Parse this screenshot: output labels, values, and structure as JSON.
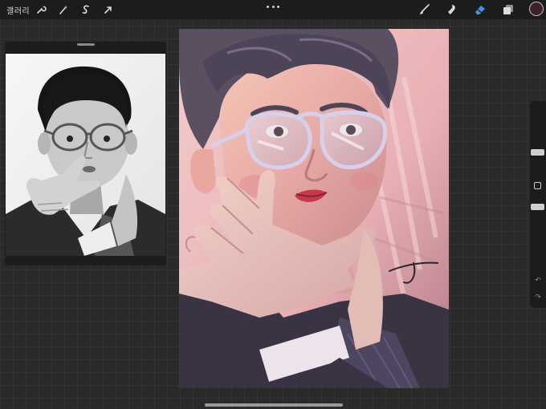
{
  "toolbar": {
    "gallery_label": "갤러리",
    "left_tools": [
      {
        "name": "actions",
        "icon": "wrench-icon"
      },
      {
        "name": "adjustments",
        "icon": "magic-wand-icon"
      },
      {
        "name": "selection",
        "icon": "selection-s-icon"
      },
      {
        "name": "transform",
        "icon": "arrow-cursor-icon"
      }
    ],
    "right_tools": [
      {
        "name": "brush",
        "icon": "brush-icon",
        "active": false
      },
      {
        "name": "smudge",
        "icon": "smudge-icon",
        "active": false
      },
      {
        "name": "eraser",
        "icon": "eraser-icon",
        "active": true
      },
      {
        "name": "layers",
        "icon": "layers-icon",
        "active": false
      }
    ],
    "active_color": "#3a2226",
    "accent_color": "#4a90e2"
  },
  "reference": {
    "title": "reference-window"
  },
  "canvas": {
    "background_color": "#f0c4c4"
  },
  "sidebar": {
    "brush_size_level": 0.25,
    "opacity_level": 0.5,
    "undo_icon": "undo-icon",
    "redo_icon": "redo-icon"
  }
}
